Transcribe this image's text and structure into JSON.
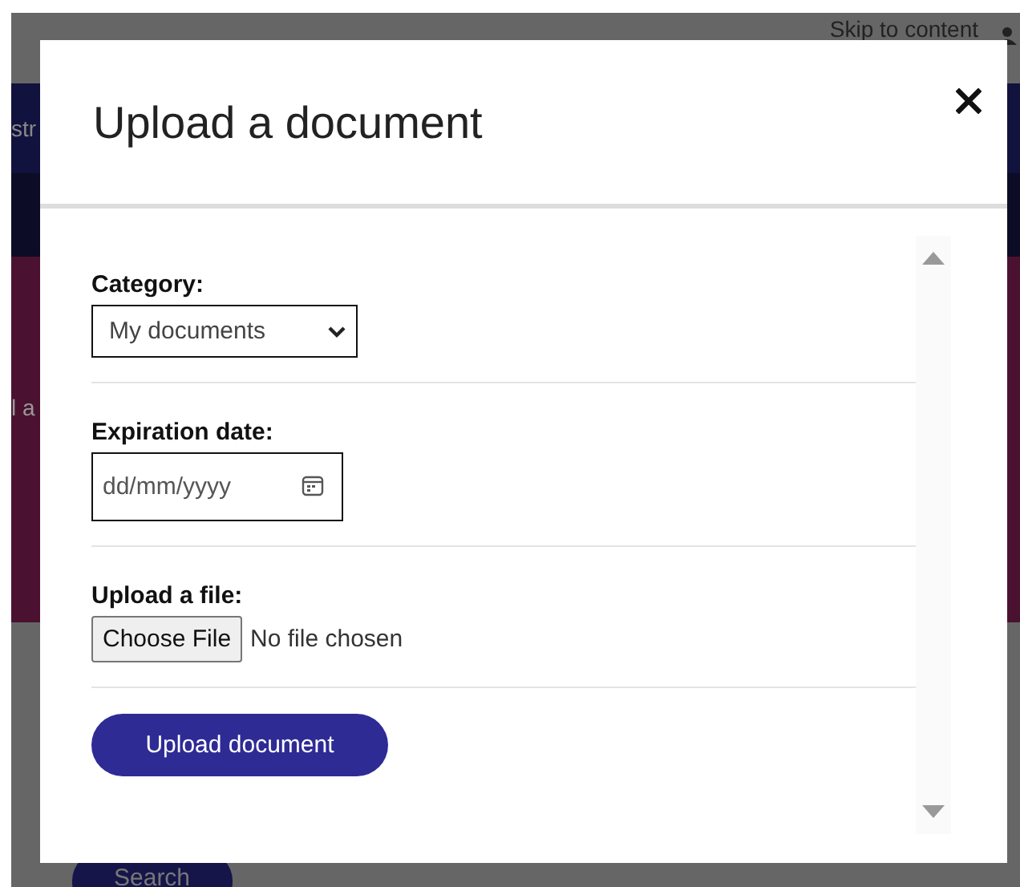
{
  "background_page": {
    "skip_link": "Skip to content",
    "nav_fragment": "str",
    "body_fragment": "l a",
    "search_button": "Search"
  },
  "dialog": {
    "title": "Upload a document",
    "fields": [
      {
        "kind": "select",
        "label": "Category:",
        "value": "My documents"
      },
      {
        "kind": "date",
        "label": "Expiration date:",
        "placeholder": "dd/mm/yyyy"
      },
      {
        "kind": "file",
        "label": "Upload a file:",
        "button": "Choose File",
        "status": "No file chosen"
      }
    ],
    "submit": "Upload document"
  }
}
